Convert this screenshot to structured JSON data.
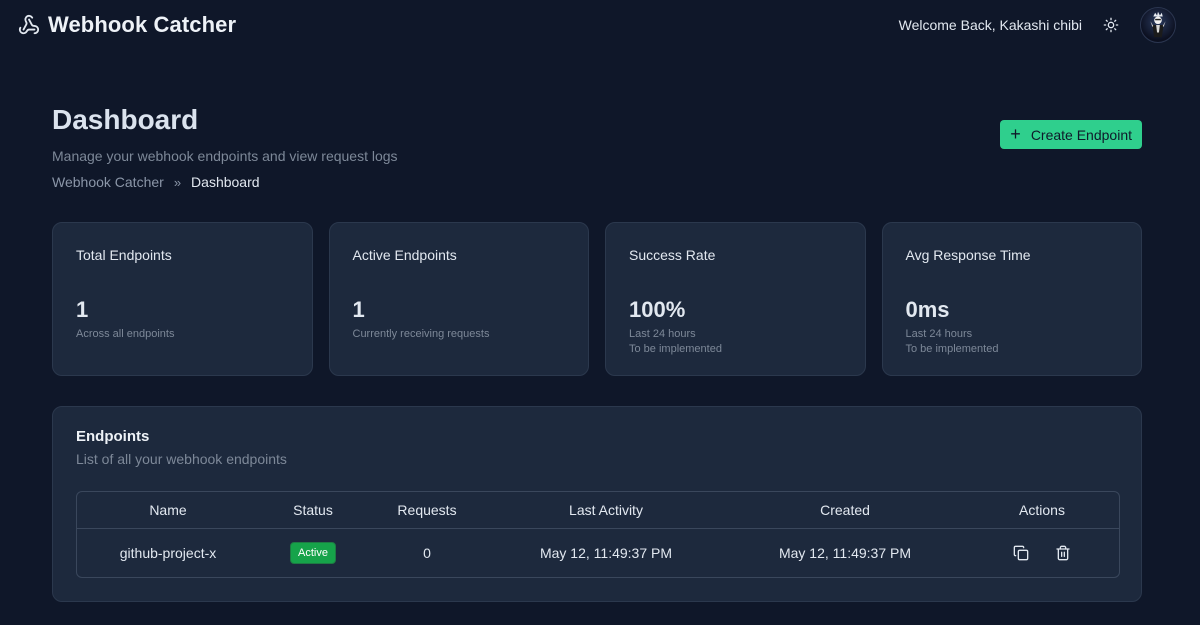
{
  "app": {
    "title": "Webhook Catcher",
    "welcome": "Welcome Back, Kakashi chibi"
  },
  "page": {
    "title": "Dashboard",
    "subtitle": "Manage your webhook endpoints and view request logs",
    "breadcrumb": [
      "Webhook Catcher",
      "Dashboard"
    ],
    "create_button": "Create Endpoint"
  },
  "stats": [
    {
      "label": "Total Endpoints",
      "value": "1",
      "notes": [
        "Across all endpoints"
      ]
    },
    {
      "label": "Active Endpoints",
      "value": "1",
      "notes": [
        "Currently receiving requests"
      ]
    },
    {
      "label": "Success Rate",
      "value": "100%",
      "notes": [
        "Last 24 hours",
        "To be implemented"
      ]
    },
    {
      "label": "Avg Response Time",
      "value": "0ms",
      "notes": [
        "Last 24 hours",
        "To be implemented"
      ]
    }
  ],
  "endpoints": {
    "title": "Endpoints",
    "subtitle": "List of all your webhook endpoints",
    "columns": [
      "Name",
      "Status",
      "Requests",
      "Last Activity",
      "Created",
      "Actions"
    ],
    "rows": [
      {
        "name": "github-project-x",
        "status": "Active",
        "requests": "0",
        "last_activity": "May 12, 11:49:37 PM",
        "created": "May 12, 11:49:37 PM"
      }
    ]
  },
  "colors": {
    "background": "#0f1729",
    "card": "#1d293d",
    "accent": "#2fcf8d",
    "active_badge": "#16a34a"
  },
  "icons": [
    "webhook-icon",
    "sun-icon",
    "plus-icon",
    "copy-icon",
    "trash-icon"
  ]
}
